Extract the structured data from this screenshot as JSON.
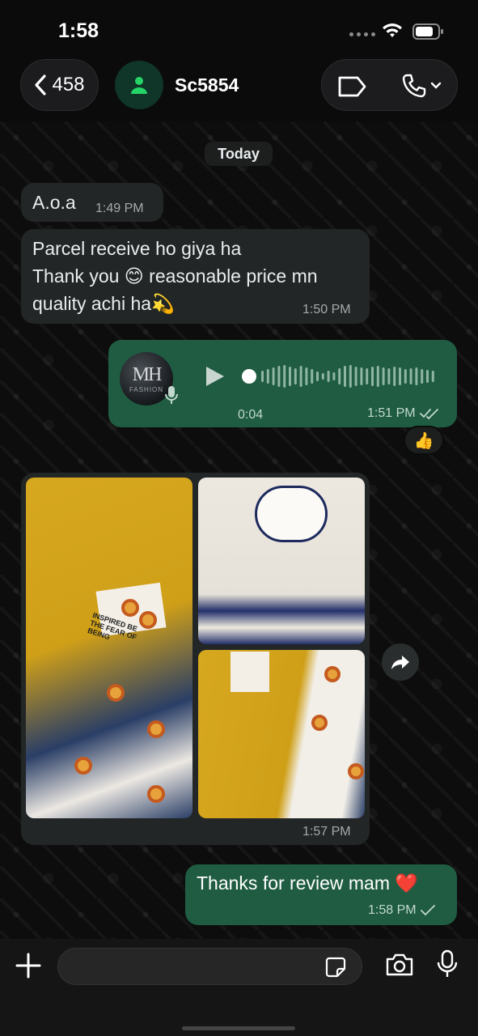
{
  "status_bar": {
    "time": "1:58"
  },
  "header": {
    "back_count": "458",
    "contact_name": "Sc5854"
  },
  "chat": {
    "day_label": "Today",
    "messages": [
      {
        "direction": "in",
        "text": "A.o.a",
        "time": "1:49 PM"
      },
      {
        "direction": "in",
        "lines": [
          "Parcel receive ho giya ha",
          "Thank you 😊 reasonable price mn",
          "quality achi ha💫"
        ],
        "time": "1:50 PM"
      },
      {
        "direction": "out",
        "type": "voice",
        "avatar_text": "MH",
        "avatar_subtext": "FASHION",
        "duration": "0:04",
        "time": "1:51 PM",
        "status": "read",
        "reaction": "👍"
      },
      {
        "direction": "in",
        "type": "album",
        "photo_count": 3,
        "time": "1:57 PM",
        "print_text": "INSPIRED BE THE FEAR OF BEING"
      },
      {
        "direction": "out",
        "text": "Thanks for review mam ❤️",
        "time": "1:58 PM",
        "status": "sent"
      }
    ]
  },
  "composer": {
    "placeholder": ""
  },
  "colors": {
    "incoming_bubble": "#232626",
    "outgoing_bubble": "#1f5c42",
    "background": "#0b0b0b",
    "avatar_bg": "#103529",
    "avatar_icon": "#25d366"
  },
  "icons": [
    "chevron-left-icon",
    "person-icon",
    "label-icon",
    "phone-icon",
    "chevron-down-icon",
    "play-icon",
    "mic-icon",
    "double-check-icon",
    "check-icon",
    "forward-icon",
    "plus-icon",
    "sticker-icon",
    "camera-icon"
  ]
}
